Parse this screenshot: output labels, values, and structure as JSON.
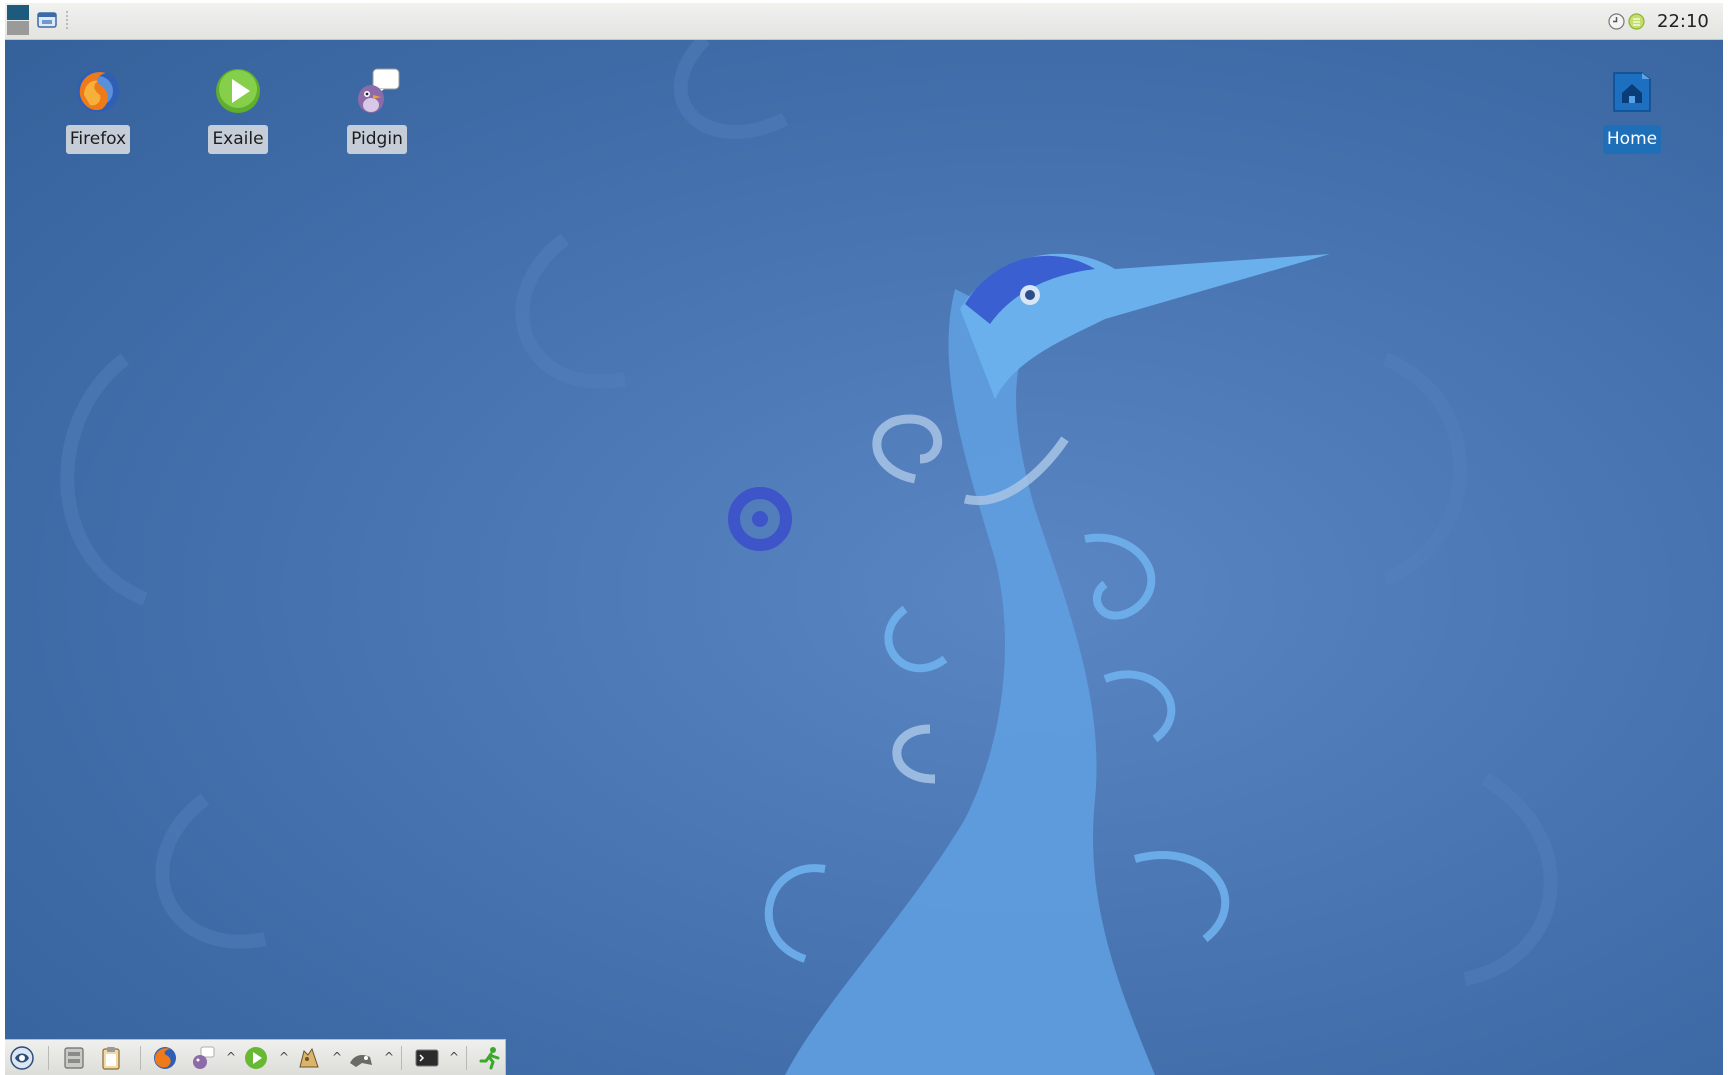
{
  "top_panel": {
    "clock": "22:10"
  },
  "desktop": {
    "icons": [
      {
        "label": "Firefox",
        "icon": "firefox-icon"
      },
      {
        "label": "Exaile",
        "icon": "exaile-icon"
      },
      {
        "label": "Pidgin",
        "icon": "pidgin-icon"
      },
      {
        "label": "Home",
        "icon": "home-folder-icon",
        "selected": true
      }
    ]
  },
  "bottom_panel": {
    "launchers": [
      "main-menu-icon",
      "file-manager-icon",
      "clipboard-icon",
      "firefox-icon",
      "pidgin-icon",
      "exaile-icon",
      "gimp-icon",
      "terminal-icon",
      "run-icon"
    ]
  },
  "colors": {
    "desktop_bg": "#4c78b6",
    "panel_bg": "#e8e8e6",
    "selection": "#1f6fb8"
  }
}
